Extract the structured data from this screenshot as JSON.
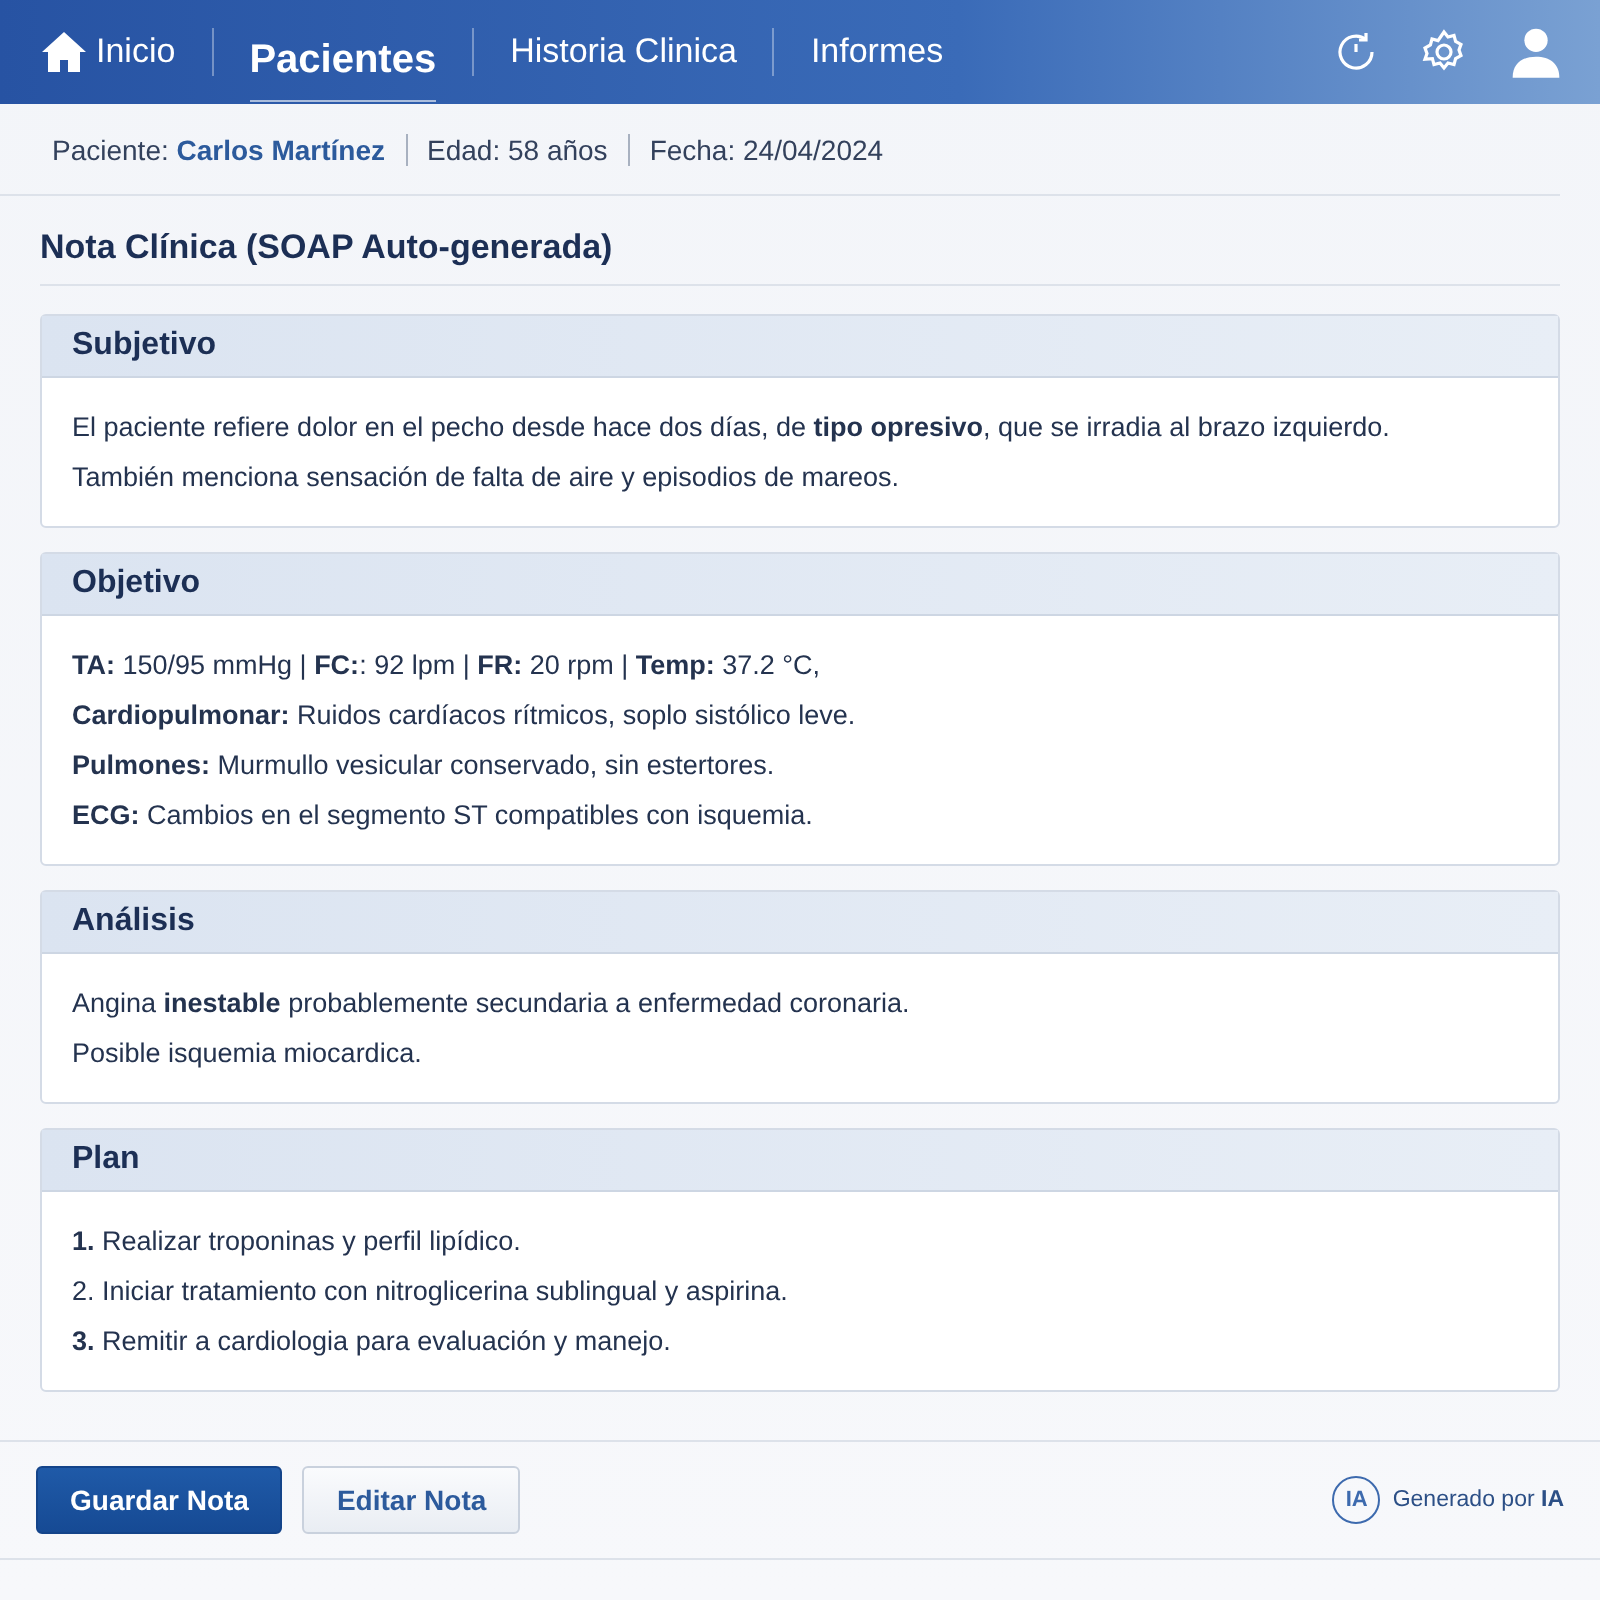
{
  "nav": {
    "items": [
      {
        "label": "Inicio",
        "kind": "home",
        "selected": false
      },
      {
        "label": "Pacientes",
        "kind": "text",
        "selected": true
      },
      {
        "label": "Historia Clinica",
        "kind": "text",
        "selected": false
      },
      {
        "label": "Informes",
        "kind": "text",
        "selected": false
      }
    ]
  },
  "patient_bar": {
    "patient_label": "Paciente:",
    "patient_name": "Carlos Martínez",
    "age": "Edad: 58 años",
    "date": "Fecha: 24/04/2024"
  },
  "title": "Nota Clínica (SOAP Auto-generada)",
  "sections": [
    {
      "heading": "Subjetivo",
      "lines": [
        "El paciente refiere dolor en el pecho desde hace dos días, de **tipo opresivo**, que se irradia al brazo izquierdo.",
        "También menciona sensación de falta de aire y episodios de mareos."
      ]
    },
    {
      "heading": "Objetivo",
      "lines": [
        "**TA:** 150/95 mmHg | **FC:**: 92 lpm | **FR:** 20 rpm | **Temp:** 37.2 °C,",
        "**Cardiopulmonar:** Ruidos cardíacos rítmicos, soplo sistólico leve.",
        "**Pulmones:** Murmullo vesicular conservado, sin estertores.",
        "**ECG:** Cambios en el segmento ST compatibles con isquemia."
      ]
    },
    {
      "heading": "Análisis",
      "lines": [
        "Angina **inestable** probablemente secundaria a enfermedad coronaria.",
        "Posible isquemia miocardica."
      ]
    },
    {
      "heading": "Plan",
      "lines": [
        "**1.** Realizar troponinas y perfil lipídico.",
        "2. Iniciar tratamiento con nitroglicerina sublingual y aspirina.",
        "**3.** Remitir a cardiologia para evaluación y manejo."
      ]
    }
  ],
  "buttons": [
    {
      "label": "Guardar Nota",
      "kind": "primary"
    },
    {
      "label": "Editar Nota",
      "kind": "secondary"
    }
  ],
  "ai_badge": {
    "icon_text": "IA",
    "label": "Generado por **IA**"
  }
}
